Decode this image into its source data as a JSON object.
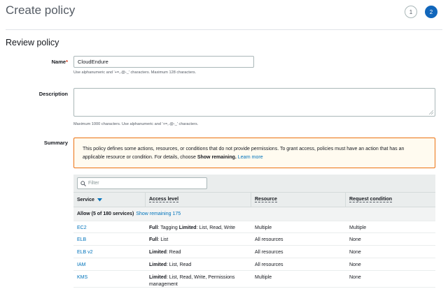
{
  "header": {
    "title": "Create policy",
    "steps": [
      "1",
      "2"
    ]
  },
  "section_title": "Review policy",
  "form": {
    "name_label": "Name",
    "name_required_mark": "*",
    "name_value": "CloudEndure",
    "name_hint": "Use alphanumeric and '+=,.@-_' characters. Maximum 128 characters.",
    "description_label": "Description",
    "description_value": "",
    "description_hint": "Maximum 1000 characters. Use alphanumeric and '+=,.@-_' characters.",
    "summary_label": "Summary"
  },
  "warning": {
    "text": "This policy defines some actions, resources, or conditions that do not provide permissions. To grant access, policies must have an action that has an applicable resource or condition. For details, choose ",
    "bold": "Show remaining.",
    "link": "Learn more"
  },
  "table": {
    "filter_placeholder": "Filter",
    "columns": [
      "Service",
      "Access level",
      "Resource",
      "Request condition"
    ],
    "group": {
      "label": "Allow (5 of 180 services)",
      "link": "Show remaining 175"
    },
    "rows": [
      {
        "service": "EC2",
        "access_strong1": "Full",
        "access_text1": ": Tagging ",
        "access_strong2": "Limited",
        "access_text2": ": List, Read, Write",
        "resource": "Multiple",
        "condition": "Multiple"
      },
      {
        "service": "ELB",
        "access_strong1": "Full",
        "access_text1": ": List",
        "access_strong2": "",
        "access_text2": "",
        "resource": "All resources",
        "condition": "None"
      },
      {
        "service": "ELB v2",
        "access_strong1": "Limited",
        "access_text1": ": Read",
        "access_strong2": "",
        "access_text2": "",
        "resource": "All resources",
        "condition": "None"
      },
      {
        "service": "IAM",
        "access_strong1": "Limited",
        "access_text1": ": List, Read",
        "access_strong2": "",
        "access_text2": "",
        "resource": "All resources",
        "condition": "None"
      },
      {
        "service": "KMS",
        "access_strong1": "Limited",
        "access_text1": ": List, Read, Write, Permissions management",
        "access_strong2": "",
        "access_text2": "",
        "resource": "Multiple",
        "condition": "None"
      }
    ]
  },
  "colors": {
    "accent": "#1166bb",
    "link": "#0073bb",
    "warning_border": "#ec7211",
    "warning_bg": "#fffbf0"
  }
}
